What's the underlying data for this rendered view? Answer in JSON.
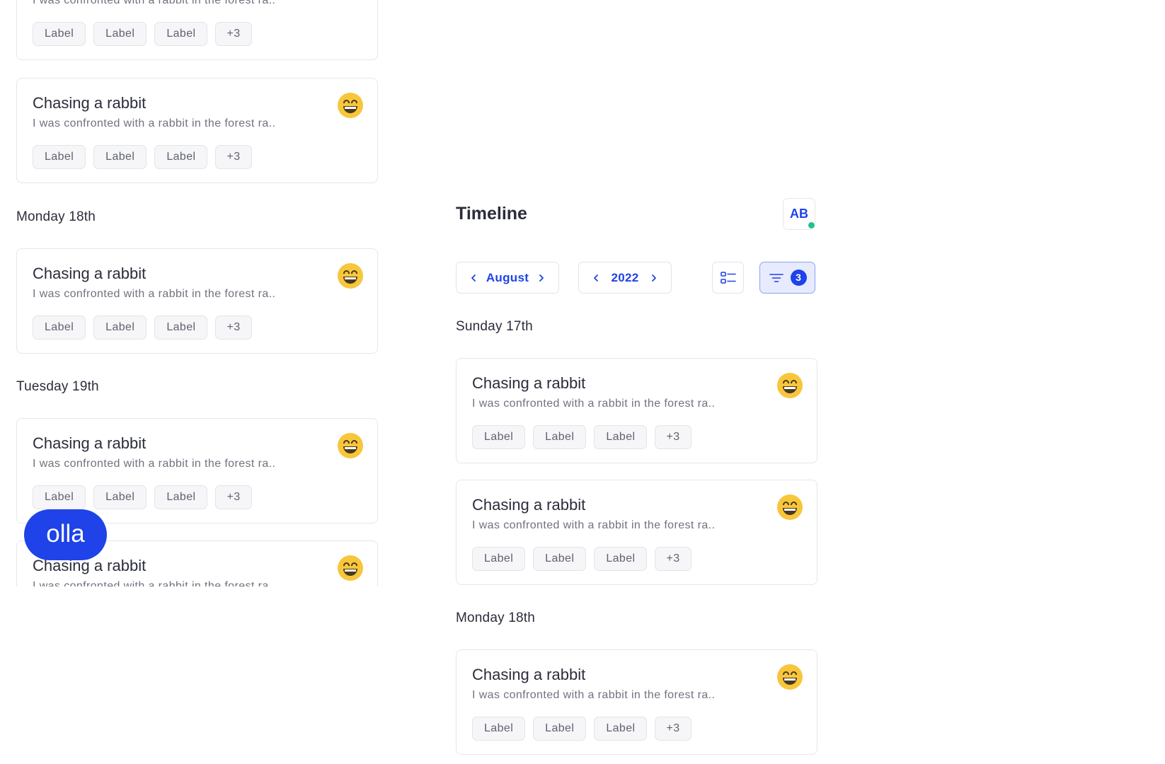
{
  "brand": {
    "badge": "olla"
  },
  "card_template": {
    "title": "Chasing a rabbit",
    "description": "I was confronted with a rabbit in the forest ra..",
    "labels": [
      "Label",
      "Label",
      "Label"
    ],
    "more_count": "+3",
    "emoji": "grinning-face-icon"
  },
  "left_list": {
    "days": [
      {
        "heading": "Monday 18th"
      },
      {
        "heading": "Tuesday 19th"
      }
    ]
  },
  "timeline": {
    "title": "Timeline",
    "avatar_initials": "AB",
    "month": "August",
    "year": "2022",
    "filter_count": "3",
    "days": [
      {
        "heading": "Sunday 17th"
      },
      {
        "heading": "Monday 18th"
      }
    ]
  },
  "colors": {
    "accent": "#1f43e8",
    "status_online": "#22c08a",
    "emoji_yellow": "#f7c63b"
  }
}
